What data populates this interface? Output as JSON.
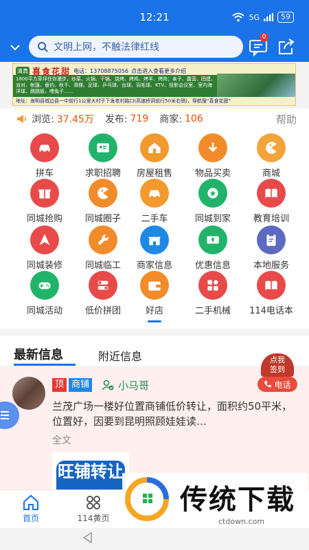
{
  "status": {
    "time": "12:21",
    "network": "5G",
    "battery": "59"
  },
  "search": {
    "placeholder": "文明上网，不触法律红线"
  },
  "header": {
    "message_badge": "0"
  },
  "banner": {
    "logo": "清真",
    "title": "喜食花甜",
    "phone": "电话：13708875056",
    "hint": "点击进入查看更多介绍",
    "body": "1800平方草坪任你漫步，炒菜、火锅、干锅、烧烤、烤鸡、烤羊、烤肉；亲子、露营、团建、派对、帐篷、垂钓、秋千、滑梯、足球、乒乓球、台球、羽毛球、KTV、投影会议室、室内海洋球、跳跳板、喂兔子……",
    "address": "地址：嵩明县城边县一中前行1公里大村子下发老村路口(高速桥洞前行50米右侧)，导航搜“喜食花甜”"
  },
  "stats": {
    "views_label": "浏览:",
    "views_value": "37.45万",
    "posts_label": "发布:",
    "posts_value": "719",
    "merchants_label": "商家:",
    "merchants_value": "106",
    "help": "帮助"
  },
  "grid": [
    {
      "label": "拼车",
      "icon": "car-icon",
      "color": "#e84a4a"
    },
    {
      "label": "求职招聘",
      "icon": "id-card-icon",
      "color": "#21b36a"
    },
    {
      "label": "房屋租售",
      "icon": "house-icon",
      "color": "#f29a2e"
    },
    {
      "label": "物品买卖",
      "icon": "download-icon",
      "color": "#f28c2a"
    },
    {
      "label": "商城",
      "icon": "pacman-icon",
      "color": "#f2a43a"
    },
    {
      "label": "同城抢购",
      "icon": "gift-icon",
      "color": "#e84a4a"
    },
    {
      "label": "同城圈子",
      "icon": "pacman-icon",
      "color": "#f28c2a"
    },
    {
      "label": "二手车",
      "icon": "car-icon",
      "color": "#f29a2e"
    },
    {
      "label": "同城到家",
      "icon": "star-badge-icon",
      "color": "#21b36a"
    },
    {
      "label": "教育培训",
      "icon": "book-icon",
      "color": "#e84a4a"
    },
    {
      "label": "同城装修",
      "icon": "arrow-icon",
      "color": "#e84a4a"
    },
    {
      "label": "同城临工",
      "icon": "wrench-icon",
      "color": "#f28c2a"
    },
    {
      "label": "商家信息",
      "icon": "shop-icon",
      "color": "#1e88e5"
    },
    {
      "label": "优惠信息",
      "icon": "coupon-icon",
      "color": "#21b36a"
    },
    {
      "label": "本地服务",
      "icon": "clipboard-icon",
      "color": "#5c6bc0"
    },
    {
      "label": "同城活动",
      "icon": "gamepad-icon",
      "color": "#21b36a"
    },
    {
      "label": "低价拼团",
      "icon": "toggle-icon",
      "color": "#e84a4a"
    },
    {
      "label": "好店",
      "icon": "wallet-icon",
      "color": "#f28c2a"
    },
    {
      "label": "二手机械",
      "icon": "apps-icon",
      "color": "#e84a4a"
    },
    {
      "label": "114电话本",
      "icon": "book-icon",
      "color": "#e84a4a"
    }
  ],
  "tabs": {
    "latest": "最新信息",
    "nearby": "附近信息"
  },
  "checkin": {
    "line1": "点我",
    "line2": "签到"
  },
  "call": {
    "label": "电话"
  },
  "post": {
    "tag_top": "顶",
    "tag_shop": "商铺",
    "username": "小马哥",
    "text": "兰茂广场一楼好位置商铺低价转让，面积约50平米，位置好，因要到昆明照顾娃娃读…",
    "full_text": "全文",
    "thumb_text": "旺铺转让"
  },
  "bottom_nav": {
    "home": "首页",
    "yellow_pages": "114黄页"
  },
  "watermark": {
    "text": "传统下载",
    "url": "ctdown.com"
  }
}
